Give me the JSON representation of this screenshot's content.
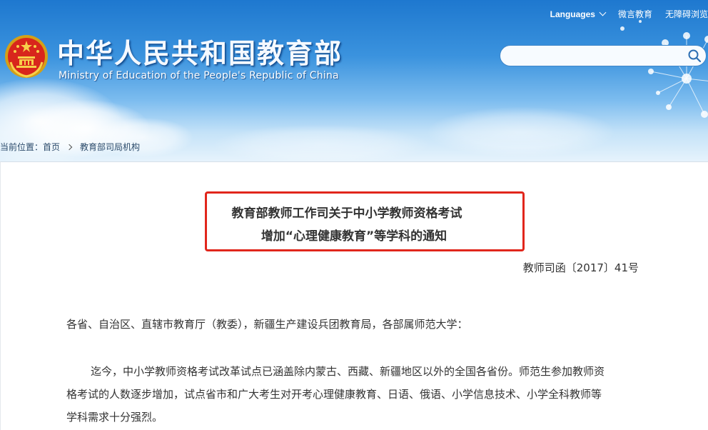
{
  "header": {
    "title_cn": "中华人民共和国教育部",
    "title_en": "Ministry of Education of the People's Republic of China",
    "languages_label": "Languages",
    "links": [
      "微言教育",
      "无障碍浏览"
    ],
    "search": {
      "value": "",
      "placeholder": ""
    },
    "colors": {
      "sky_top": "#1e78cf",
      "sky_bottom": "#e6f3fc"
    }
  },
  "breadcrumb": {
    "prefix": "当前位置：",
    "items": [
      "首页",
      "教育部司局机构"
    ]
  },
  "article": {
    "title_lines": [
      "教育部教师工作司关于中小学教师资格考试",
      "增加“心理健康教育”等学科的通知"
    ],
    "doc_number": "教师司函〔2017〕41号",
    "salutation": "各省、自治区、直辖市教育厅（教委），新疆生产建设兵团教育局，各部属师范大学：",
    "body_lines": [
      "迄今，中小学教师资格考试改革试点已涵盖除内蒙古、西藏、新疆地区以外的全国各省份。师范生参加教师资",
      "格考试的人数逐步增加，试点省市和广大考生对开考心理健康教育、日语、俄语、小学信息技术、小学全科教师等",
      "学科需求十分强烈。"
    ],
    "highlight_color": "#e1261c"
  }
}
